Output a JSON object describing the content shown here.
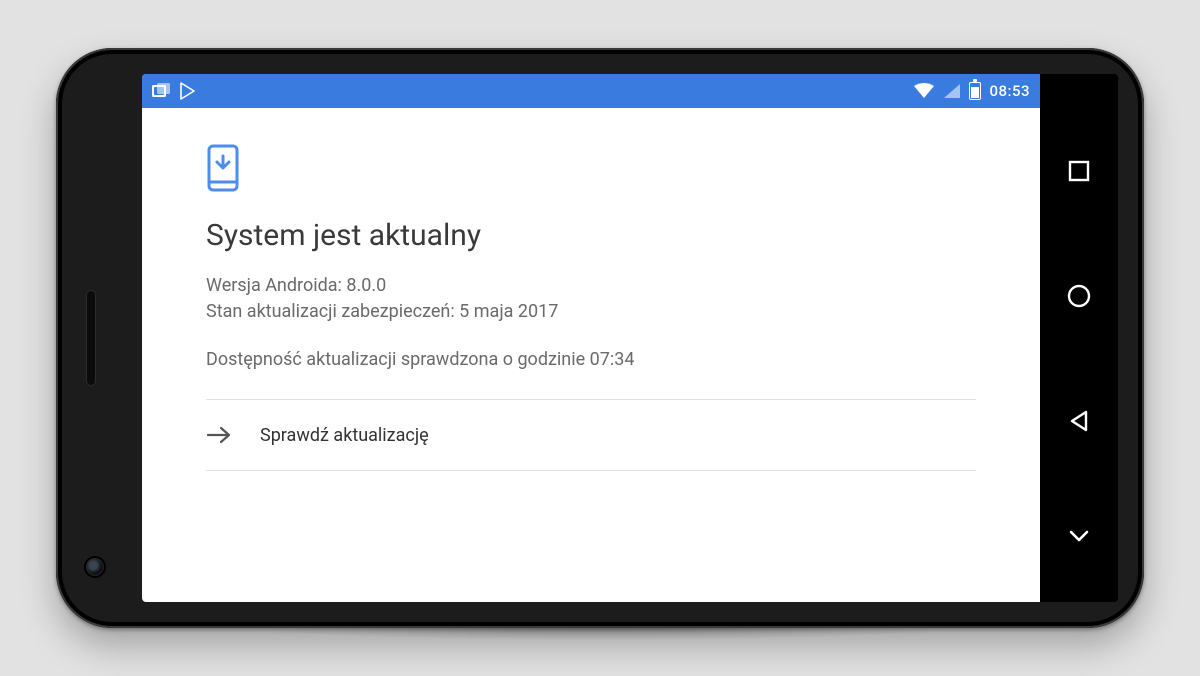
{
  "statusbar": {
    "time": "08:53"
  },
  "page": {
    "title": "System jest aktualny",
    "version_line": "Wersja Androida: 8.0.0",
    "security_line": "Stan aktualizacji zabezpieczeń: 5 maja 2017",
    "checked_line": "Dostępność aktualizacji sprawdzona o godzinie 07:34",
    "check_button": "Sprawdź aktualizację"
  }
}
